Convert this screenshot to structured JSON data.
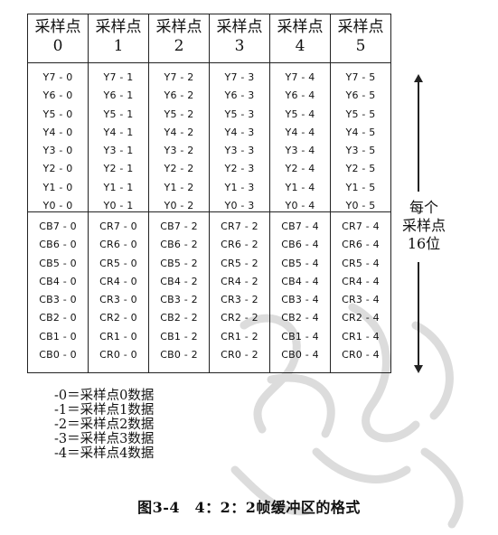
{
  "columns": [
    {
      "header": [
        "采样点",
        "0"
      ],
      "y": [
        "Y7 - 0",
        "Y6 - 0",
        "Y5 - 0",
        "Y4 - 0",
        "Y3 - 0",
        "Y2 - 0",
        "Y1 - 0",
        "Y0 - 0"
      ],
      "c": [
        "CB7 - 0",
        "CB6 - 0",
        "CB5 - 0",
        "CB4 - 0",
        "CB3 - 0",
        "CB2 - 0",
        "CB1 - 0",
        "CB0 - 0"
      ]
    },
    {
      "header": [
        "采样点",
        "1"
      ],
      "y": [
        "Y7 - 1",
        "Y6 - 1",
        "Y5 - 1",
        "Y4 - 1",
        "Y3 - 1",
        "Y2 - 1",
        "Y1 - 1",
        "Y0 - 1"
      ],
      "c": [
        "CR7 - 0",
        "CR6 - 0",
        "CR5 - 0",
        "CR4 - 0",
        "CR3 - 0",
        "CR2 - 0",
        "CR1 - 0",
        "CR0 - 0"
      ]
    },
    {
      "header": [
        "采样点",
        "2"
      ],
      "y": [
        "Y7 - 2",
        "Y6 - 2",
        "Y5 - 2",
        "Y4 - 2",
        "Y3 - 2",
        "Y2 - 2",
        "Y1 - 2",
        "Y0 - 2"
      ],
      "c": [
        "CB7 - 2",
        "CB6 - 2",
        "CB5 - 2",
        "CB4 - 2",
        "CB3 - 2",
        "CB2 - 2",
        "CB1 - 2",
        "CB0 - 2"
      ]
    },
    {
      "header": [
        "采样点",
        "3"
      ],
      "y": [
        "Y7 - 3",
        "Y6 - 3",
        "Y5 - 3",
        "Y4 - 3",
        "Y3 - 3",
        "Y2 - 3",
        "Y1 - 3",
        "Y0 - 3"
      ],
      "c": [
        "CR7 - 2",
        "CR6 - 2",
        "CR5 - 2",
        "CR4 - 2",
        "CR3 - 2",
        "CR2 - 2",
        "CR1 - 2",
        "CR0 - 2"
      ]
    },
    {
      "header": [
        "采样点",
        "4"
      ],
      "y": [
        "Y7 - 4",
        "Y6 - 4",
        "Y5 - 4",
        "Y4 - 4",
        "Y3 - 4",
        "Y2 - 4",
        "Y1 - 4",
        "Y0 - 4"
      ],
      "c": [
        "CB7 - 4",
        "CB6 - 4",
        "CB5 - 4",
        "CB4 - 4",
        "CB3 - 4",
        "CB2 - 4",
        "CB1 - 4",
        "CB0 - 4"
      ]
    },
    {
      "header": [
        "采样点",
        "5"
      ],
      "y": [
        "Y7 - 5",
        "Y6 - 5",
        "Y5 - 5",
        "Y4 - 5",
        "Y3 - 5",
        "Y2 - 5",
        "Y1 - 5",
        "Y0 - 5"
      ],
      "c": [
        "CR7 - 4",
        "CR6 - 4",
        "CR5 - 4",
        "CR4 - 4",
        "CR3 - 4",
        "CR2 - 4",
        "CR1 - 4",
        "CR0 - 4"
      ]
    }
  ],
  "side_label": [
    "每个",
    "采样点",
    "16位"
  ],
  "legend": [
    "-0＝采样点0数据",
    "-1＝采样点1数据",
    "-2＝采样点2数据",
    "-3＝采样点3数据",
    "-4＝采样点4数据"
  ],
  "caption": "图3-4　4：2：2帧缓冲区的格式",
  "colors": {
    "line": "#222222",
    "text": "#111111",
    "watermark": "#dcdcdc"
  }
}
